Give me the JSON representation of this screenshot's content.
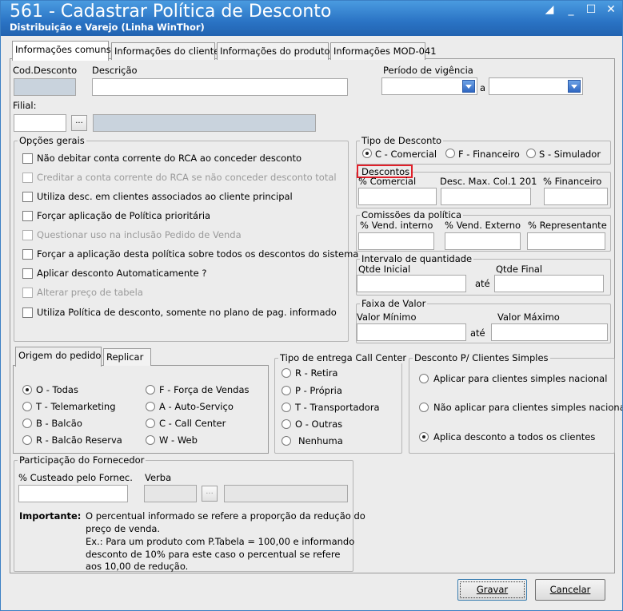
{
  "window": {
    "title": "561 - Cadastrar Política de Desconto",
    "subtitle": "Distribuição e Varejo (Linha WinThor)"
  },
  "tabs": [
    "Informações comuns",
    "Informações do cliente",
    "Informações do produto",
    "Informações MOD-041"
  ],
  "fields": {
    "cod_desconto": "Cod.Desconto",
    "descricao": "Descrição",
    "periodo": "Período de vigência",
    "a": "a",
    "filial": "Filial:",
    "filial_btn": "..."
  },
  "opcoes": {
    "title": "Opções gerais",
    "items": [
      {
        "label": "Não debitar conta corrente do RCA ao conceder desconto",
        "enabled": true
      },
      {
        "label": "Creditar a conta corrente do RCA se não conceder desconto total",
        "enabled": false
      },
      {
        "label": "Utiliza desc. em clientes associados ao cliente principal",
        "enabled": true
      },
      {
        "label": "Forçar aplicação de Política prioritária",
        "enabled": true
      },
      {
        "label": "Questionar uso na inclusão Pedido de Venda",
        "enabled": false
      },
      {
        "label": "Forçar a aplicação desta política sobre todos os descontos do sistema",
        "enabled": true
      },
      {
        "label": "Aplicar desconto Automaticamente ?",
        "enabled": true
      },
      {
        "label": "Alterar preço de tabela",
        "enabled": false
      },
      {
        "label": "Utiliza Política de desconto, somente no plano de pag. informado",
        "enabled": true
      }
    ]
  },
  "tipo_desconto": {
    "title": "Tipo de Desconto",
    "options": [
      "C - Comercial",
      "F - Financeiro",
      "S - Simulador"
    ],
    "selected": 0
  },
  "descontos": {
    "title": "Descontos",
    "cols": [
      "% Comercial",
      "Desc. Max. Col.1 201",
      "% Financeiro"
    ]
  },
  "comissoes": {
    "title": "Comissões da política",
    "cols": [
      "% Vend. interno",
      "% Vend. Externo",
      "% Representante"
    ]
  },
  "intervalo": {
    "title": "Intervalo de quantidade",
    "ini": "Qtde Inicial",
    "ate": "até",
    "fim": "Qtde Final"
  },
  "faixa": {
    "title": "Faixa de Valor",
    "min": "Valor Mínimo",
    "ate": "até",
    "max": "Valor Máximo"
  },
  "origem": {
    "tabs": [
      "Origem do pedido",
      "Replicar"
    ],
    "options": [
      "O - Todas",
      "F - Força de Vendas",
      "T - Telemarketing",
      "A - Auto-Serviço",
      "B - Balcão",
      "C - Call Center",
      "R - Balcão Reserva",
      "W - Web"
    ],
    "selected": 0
  },
  "entrega": {
    "title": "Tipo de entrega Call Center",
    "options": [
      "R - Retira",
      "P - Própria",
      "T - Transportadora",
      "O - Outras",
      "Nenhuma"
    ]
  },
  "simples": {
    "title": "Desconto P/ Clientes Simples",
    "options": [
      "Aplicar para clientes simples nacional",
      "Não aplicar para clientes simples nacional",
      "Aplica desconto a todos os clientes"
    ],
    "selected": 2
  },
  "fornecedor": {
    "title": "Participação do Fornecedor",
    "custeado": "% Custeado pelo Fornec.",
    "verba": "Verba",
    "verba_btn": "...",
    "importante_label": "Importante:",
    "importante_lines": [
      "O percentual informado se refere a proporção da redução do",
      "preço de venda.",
      "Ex.: Para um produto com P.Tabela = 100,00 e informando",
      "desconto de 10% para este caso o percentual se refere",
      "aos 10,00 de redução."
    ]
  },
  "buttons": {
    "gravar": "Gravar",
    "cancelar": "Cancelar"
  },
  "colors": {
    "titlebar": "#2a73c4",
    "highlight": "#e0202a"
  }
}
